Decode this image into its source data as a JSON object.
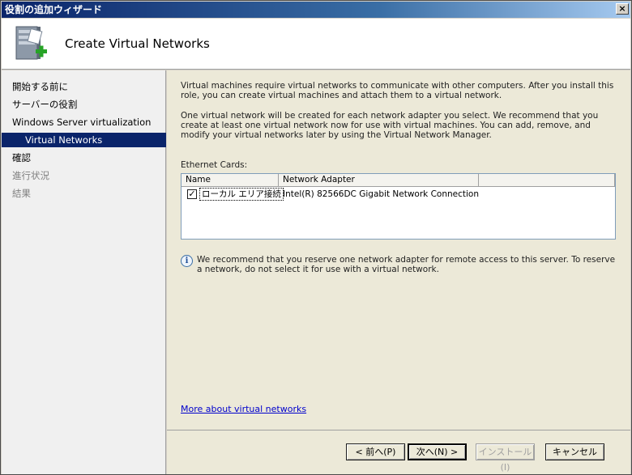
{
  "window": {
    "title": "役割の追加ウィザード",
    "close_label": "×"
  },
  "header": {
    "title": "Create Virtual Networks",
    "icon": "server-add-icon"
  },
  "nav": {
    "items": [
      {
        "label": "開始する前に",
        "state": "normal"
      },
      {
        "label": "サーバーの役割",
        "state": "normal"
      },
      {
        "label": "Windows Server virtualization",
        "state": "normal"
      },
      {
        "label": "Virtual Networks",
        "state": "active"
      },
      {
        "label": "確認",
        "state": "normal"
      },
      {
        "label": "進行状況",
        "state": "disabled"
      },
      {
        "label": "結果",
        "state": "disabled"
      }
    ]
  },
  "content": {
    "para1": "Virtual machines require virtual networks to communicate with other computers. After you install this role, you can create virtual machines and attach them to a virtual network.",
    "para2": "One virtual network will be created for each network adapter you select. We recommend that you create at least one virtual network now for use with virtual machines. You can add, remove, and modify your virtual networks later by using the Virtual Network Manager.",
    "ethernet_label": "Ethernet Cards:",
    "list": {
      "columns": [
        "Name",
        "Network Adapter",
        ""
      ],
      "rows": [
        {
          "checked": true,
          "check_mark": "✓",
          "name": "ローカル エリア接続",
          "adapter": "Intel(R) 82566DC Gigabit Network Connection"
        }
      ]
    },
    "info_icon_glyph": "i",
    "info_text": "We recommend that you reserve one network adapter for remote access to this server. To reserve a network, do not select it for use with a virtual network.",
    "more_link": "More about virtual networks"
  },
  "footer": {
    "back": "< 前へ(P)",
    "next": "次へ(N) >",
    "install": "インストール(I)",
    "cancel": "キャンセル"
  }
}
